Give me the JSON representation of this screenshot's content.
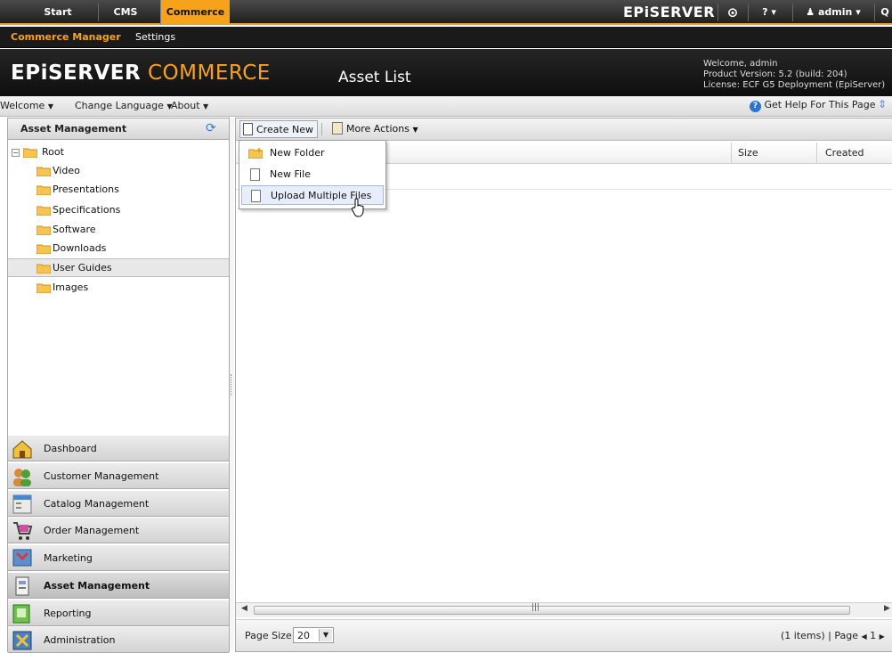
{
  "topnav": {
    "start": "Start",
    "cms": "CMS",
    "commerce": "Commerce",
    "brand": "EPiSERVER",
    "eye_label": "⊙",
    "help": "? ▾",
    "user": "admin ▾",
    "search": "Q"
  },
  "subnav": {
    "manager": "Commerce Manager",
    "settings": "Settings"
  },
  "header": {
    "logo_a": "EPiSERVER",
    "logo_b": " COMMERCE",
    "page_title": "Asset List",
    "welcome": "Welcome, admin",
    "version": "Product Version: 5.2 (build: 204)",
    "license": "License: ECF G5 Deployment (EpiServer)"
  },
  "menubar": {
    "welcome": "Welcome",
    "change_language": "Change Language",
    "about": "About",
    "help": "Get Help For This Page"
  },
  "left": {
    "title": "Asset Management",
    "tree": [
      "Root",
      "Video",
      "Presentations",
      "Specifications",
      "Software",
      "Downloads",
      "User Guides",
      "Images"
    ],
    "accordion": [
      "Dashboard",
      "Customer Management",
      "Catalog Management",
      "Order Management",
      "Marketing",
      "Asset Management",
      "Reporting",
      "Administration"
    ]
  },
  "toolbar": {
    "create_new": "Create New",
    "more_actions": "More Actions"
  },
  "menu": {
    "items": [
      "New Folder",
      "New File",
      "Upload Multiple Files"
    ]
  },
  "grid": {
    "columns": [
      "Size",
      "Created"
    ]
  },
  "footer": {
    "page_size_label": "Page Size:",
    "page_size": "20",
    "items": "(1 items) | Page",
    "page": "1"
  },
  "colors": {
    "accent": "#f7a21b",
    "dark": "#1a1a1a"
  }
}
